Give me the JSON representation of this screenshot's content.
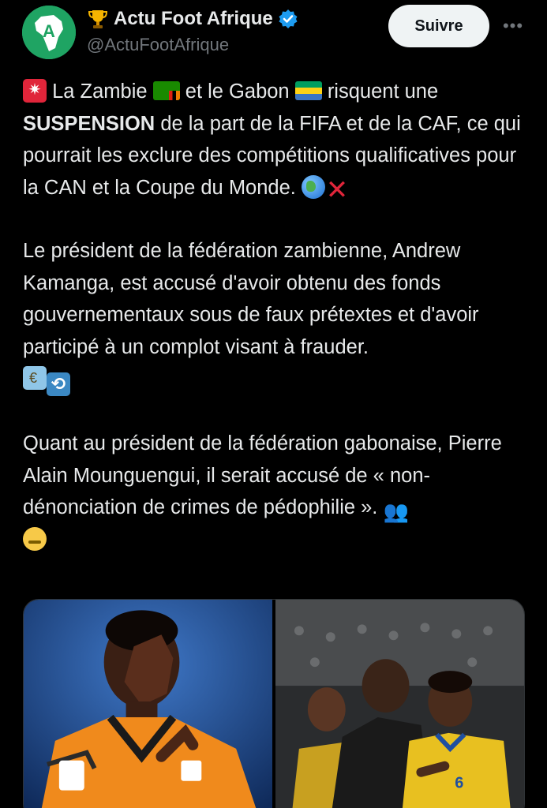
{
  "account": {
    "display_name": "Actu Foot Afrique",
    "handle": "@ActuFootAfrique",
    "verified": true,
    "follow_label": "Suivre",
    "more_icon": "more-horizontal-icon",
    "brand_color": "#1fa463",
    "verified_color": "#1d9bf0"
  },
  "tweet": {
    "p1_a": "La Zambie",
    "p1_b": "et le Gabon",
    "p1_c": "risquent une",
    "p1_bold": "SUSPENSION",
    "p1_d": "de la part de la FIFA et de la CAF, ce qui pourrait les exclure des compétitions qualificatives pour la CAN et la Coupe du Monde.",
    "p2": "Le président de la fédération zambienne, Andrew Kamanga, est accusé d'avoir obtenu des fonds gouvernementaux sous de faux prétextes et d'avoir participé à un complot visant à frauder.",
    "p3": "Quant au président de la fédération gabonaise, Pierre Alain Mounguengui, il serait accusé de « non-dénonciation de crimes de pédophilie ».",
    "emojis": [
      "siren-icon",
      "zambia-flag-icon",
      "gabon-flag-icon",
      "globe-icon",
      "cross-mark-icon",
      "money-icon",
      "repeat-icon",
      "people-icon",
      "zipper-mouth-icon"
    ]
  },
  "media": {
    "photos": [
      "zambia-player-photo",
      "gabon-coach-players-photo"
    ]
  }
}
